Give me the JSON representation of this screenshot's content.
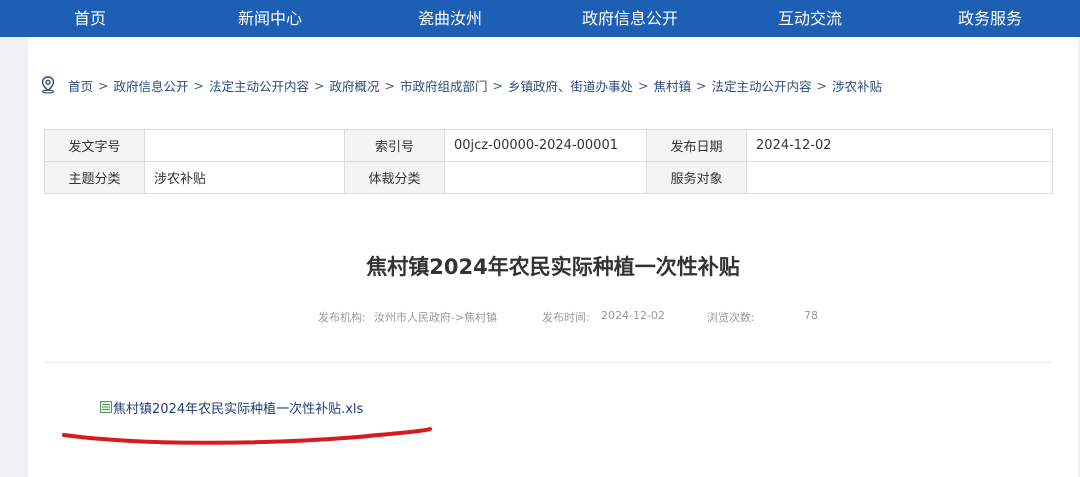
{
  "nav": {
    "items": [
      "首页",
      "新闻中心",
      "瓷曲汝州",
      "政府信息公开",
      "互动交流",
      "政务服务"
    ]
  },
  "breadcrumb": {
    "items": [
      "首页",
      "政府信息公开",
      "法定主动公开内容",
      "政府概况",
      "市政府组成部门",
      "乡镇政府、街道办事处",
      "焦村镇",
      "法定主动公开内容",
      "涉农补贴"
    ],
    "separator": ">"
  },
  "meta": {
    "doc_number_label": "发文字号",
    "doc_number_value": "",
    "index_label": "索引号",
    "index_value": "00jcz-00000-2024-00001",
    "publish_date_label": "发布日期",
    "publish_date_value": "2024-12-02",
    "topic_label": "主题分类",
    "topic_value": "涉农补贴",
    "genre_label": "体裁分类",
    "genre_value": "",
    "audience_label": "服务对象",
    "audience_value": ""
  },
  "article": {
    "title": "焦村镇2024年农民实际种植一次性补贴",
    "org_label": "发布机构:",
    "org_value": "汝州市人民政府->焦村镇",
    "time_label": "发布时间:",
    "time_value": "2024-12-02",
    "views_label": "浏览次数:",
    "views_value": "78"
  },
  "attachment": {
    "filename": "焦村镇2024年农民实际种植一次性补贴.xls",
    "icon": "excel-file-icon"
  },
  "colors": {
    "nav_bg": "#1d5fb4",
    "link": "#2c4a7a",
    "annotation": "#d8191f"
  }
}
